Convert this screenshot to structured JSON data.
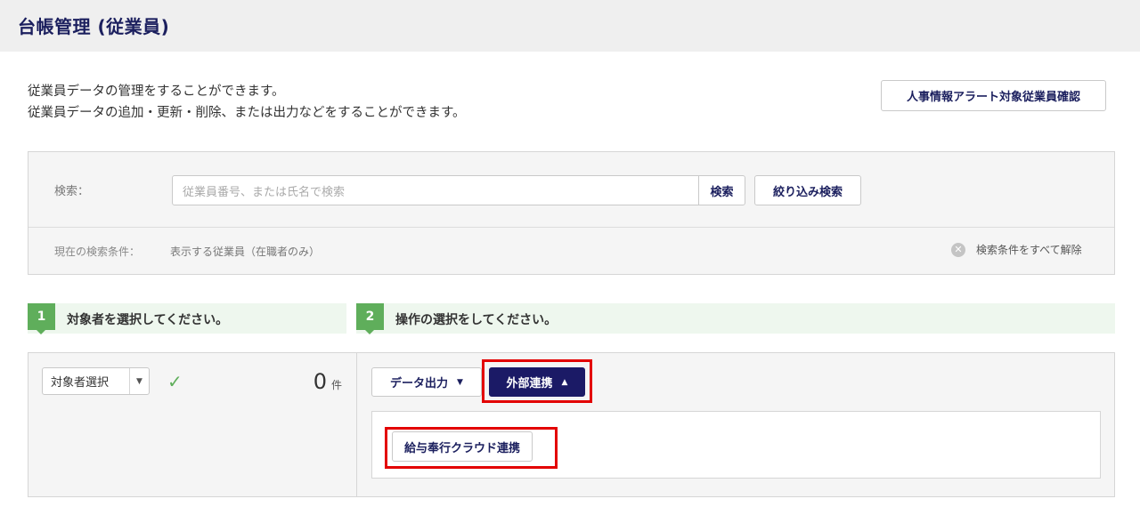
{
  "page": {
    "title": "台帳管理 (従業員)"
  },
  "description": {
    "line1": "従業員データの管理をすることができます。",
    "line2": "従業員データの追加・更新・削除、または出力などをすることができます。"
  },
  "alert_button": "人事情報アラート対象従業員確認",
  "search": {
    "label": "検索：",
    "placeholder": "従業員番号、または氏名で検索",
    "search_button": "検索",
    "filter_button": "絞り込み検索",
    "condition_label": "現在の検索条件：",
    "condition_value": "表示する従業員（在職者のみ）",
    "clear_label": "検索条件をすべて解除",
    "clear_icon": "close-circle-icon"
  },
  "steps": [
    {
      "number": "1",
      "text": "対象者を選択してください。"
    },
    {
      "number": "2",
      "text": "操作の選択をしてください。"
    }
  ],
  "left_panel": {
    "select_label": "対象者選択",
    "select_icon": "caret-down-icon",
    "check_icon": "check-icon",
    "count": "0",
    "count_unit": "件"
  },
  "right_panel": {
    "output_button": "データ出力",
    "external_button": "外部連携",
    "sub_button": "給与奉行クラウド連携"
  },
  "colors": {
    "brand_navy": "#1b1a66",
    "step_green": "#5fae5b",
    "highlight_red": "#e30000"
  }
}
